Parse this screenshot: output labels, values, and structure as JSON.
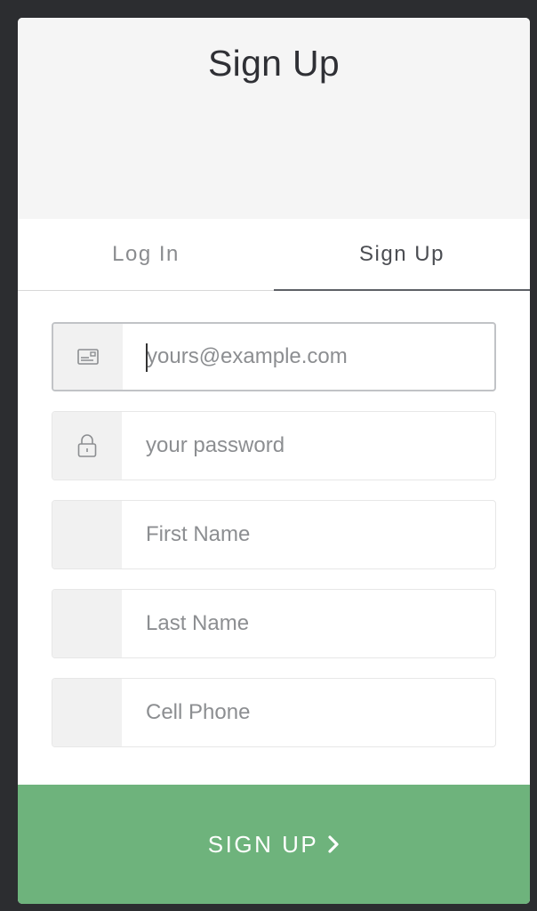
{
  "modal": {
    "title": "Sign Up"
  },
  "tabs": [
    {
      "label": "Log In",
      "active": false
    },
    {
      "label": "Sign Up",
      "active": true
    }
  ],
  "fields": {
    "email": {
      "placeholder": "yours@example.com",
      "icon": "envelope-icon"
    },
    "password": {
      "placeholder": "your password",
      "icon": "lock-icon"
    },
    "first_name": {
      "placeholder": "First Name"
    },
    "last_name": {
      "placeholder": "Last Name"
    },
    "cell_phone": {
      "placeholder": "Cell Phone"
    }
  },
  "submit": {
    "label": "SIGN UP",
    "icon": "chevron-right-icon"
  },
  "colors": {
    "accent": "#6eb37c",
    "header_bg": "#f5f5f5",
    "backdrop": "#2c2d30"
  }
}
